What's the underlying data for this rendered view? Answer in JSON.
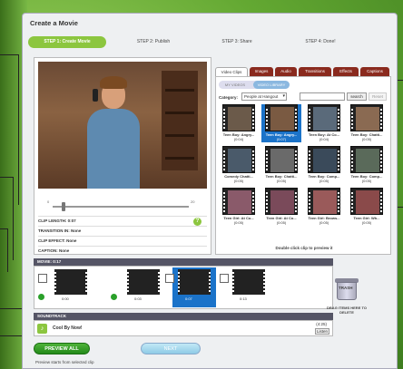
{
  "page": {
    "title": "Create a Movie"
  },
  "steps": [
    {
      "label": "STEP 1: Create Movie",
      "active": true
    },
    {
      "label": "STEP 2: Publish",
      "active": false
    },
    {
      "label": "STEP 3: Share",
      "active": false
    },
    {
      "label": "STEP 4: Done!",
      "active": false
    }
  ],
  "preview": {
    "slider_ticks": [
      "0",
      "20"
    ],
    "clip_length": "CLIP LENGTH: 0:07",
    "transition": "TRANSITION IN: None",
    "clip_effect": "CLIP EFFECT: None",
    "caption": "CAPTION: None"
  },
  "library": {
    "tabs": [
      "Video Clips",
      "Images",
      "Audio",
      "Transitions",
      "Effects",
      "Captions"
    ],
    "active_tab": "Video Clips",
    "toggle": [
      "MY VIDEOS",
      "VIDEO LIBRARY"
    ],
    "category_label": "Category:",
    "category_value": "People at Hangout",
    "search_label": "search",
    "reset_label": "Reset",
    "clips": [
      {
        "name": "Teen Boy: Angry...",
        "duration": "(0:04)",
        "selected": false
      },
      {
        "name": "Teen Boy: Angry...",
        "duration": "(0:07)",
        "selected": true
      },
      {
        "name": "Teen Boy: At Co...",
        "duration": "(0:04)",
        "selected": false
      },
      {
        "name": "Teen Boy: Chatti...",
        "duration": "(0:05)",
        "selected": false
      },
      {
        "name": "Comedy Chatti...",
        "duration": "(0:05)",
        "selected": false
      },
      {
        "name": "Teen Boy: Chatti...",
        "duration": "(0:05)",
        "selected": false
      },
      {
        "name": "Teen Boy: Comp...",
        "duration": "(0:05)",
        "selected": false
      },
      {
        "name": "Teen Boy: Comp...",
        "duration": "(0:05)",
        "selected": false
      },
      {
        "name": "Teen Girl: At Co...",
        "duration": "(0:05)",
        "selected": false
      },
      {
        "name": "Teen Girl: At Co...",
        "duration": "(0:05)",
        "selected": false
      },
      {
        "name": "Teen Girl: Brows...",
        "duration": "(0:05)",
        "selected": false
      },
      {
        "name": "Teen Girl: Wh...",
        "duration": "(0:05)",
        "selected": false
      }
    ],
    "hint": "Double click clip to preview it"
  },
  "timeline": {
    "label": "MOVIE: 0:17",
    "items": [
      {
        "time": "0:00",
        "selected": false
      },
      {
        "time": "0:03",
        "selected": false
      },
      {
        "time": "0:07",
        "selected": true
      },
      {
        "time": "0:13",
        "selected": false
      }
    ]
  },
  "trash": {
    "label": "TRASH",
    "hint": "DRAG ITEMS HERE TO DELETE"
  },
  "soundtrack": {
    "label": "SOUNDTRACK",
    "name": "Cool By Now!",
    "duration": "(4:25)",
    "listen_label": "Listen"
  },
  "buttons": {
    "preview_label": "PREVIEW ALL",
    "next_label": "NEXT",
    "preview_hint": "Preview starts from selected clip"
  }
}
